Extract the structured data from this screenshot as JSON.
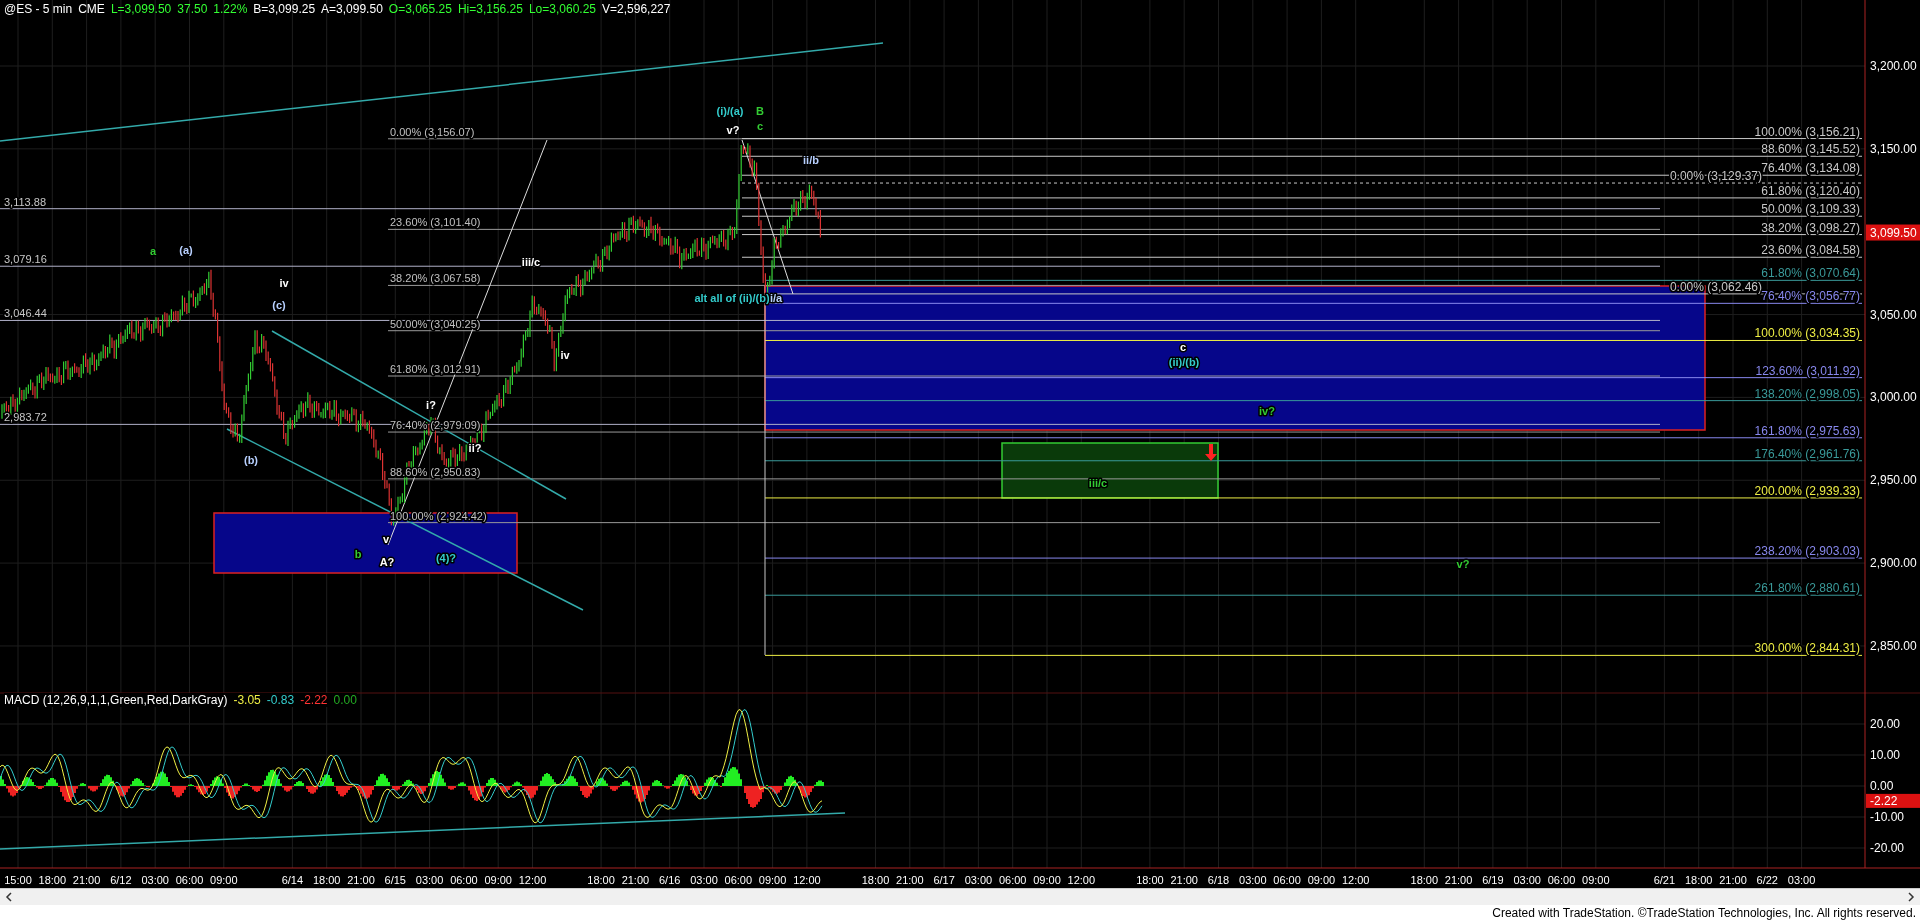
{
  "header": {
    "items": [
      {
        "text": "@ES - 5 min",
        "color": "#ffffff"
      },
      {
        "text": "CME",
        "color": "#ffffff"
      },
      {
        "text": "L=3,099.50",
        "color": "#33ff33"
      },
      {
        "text": "37.50",
        "color": "#33ff33"
      },
      {
        "text": "1.22%",
        "color": "#33ff33"
      },
      {
        "text": "B=3,099.25",
        "color": "#ffffff"
      },
      {
        "text": "A=3,099.50",
        "color": "#ffffff"
      },
      {
        "text": "O=3,065.25",
        "color": "#33ff33"
      },
      {
        "text": "Hi=3,156.25",
        "color": "#33ff33"
      },
      {
        "text": "Lo=3,060.25",
        "color": "#33ff33"
      },
      {
        "text": "V=2,596,227",
        "color": "#ffffff"
      }
    ]
  },
  "level_lines": [
    "3,113.88",
    "3,079.16",
    "3,046.44",
    "2,983.72"
  ],
  "left_fibs": [
    "0.00% (3,156.07)",
    "23.60% (3,101.40)",
    "38.20% (3,067.58)",
    "50.00% (3,040.25)",
    "61.80% (3,012.91)",
    "76.40% (2,979.09)",
    "88.60% (2,950.83)",
    "100.00% (2,924.42)"
  ],
  "right_fibs": [
    {
      "label": "100.00% (3,156.21)",
      "color": "#c8c8c8"
    },
    {
      "label": "88.60% (3,145.52)",
      "color": "#c8c8c8"
    },
    {
      "label": "76.40% (3,134.08)",
      "color": "#c8c8c8"
    },
    {
      "label": "0.00% (3,129.37)",
      "color": "#c8c8c8"
    },
    {
      "label": "61.80% (3,120.40)",
      "color": "#c8c8c8"
    },
    {
      "label": "50.00% (3,109.33)",
      "color": "#c8c8c8"
    },
    {
      "label": "38.20% (3,098.27)",
      "color": "#c8c8c8"
    },
    {
      "label": "23.60% (3,084.58)",
      "color": "#c8c8c8"
    },
    {
      "label": "61.80% (3,070.64)",
      "color": "#3a9a9a"
    },
    {
      "label": "0.00% (3,062.46)",
      "color": "#c8c8c8"
    },
    {
      "label": "76.40% (3,056.77)",
      "color": "#8888ee"
    },
    {
      "label": "100.00% (3,034.35)",
      "color": "#eeee44"
    },
    {
      "label": "123.60% (3,011.92)",
      "color": "#8888ee"
    },
    {
      "label": "138.20% (2,998.05)",
      "color": "#3a9a9a"
    },
    {
      "label": "161.80% (2,975.63)",
      "color": "#8888ee"
    },
    {
      "label": "176.40% (2,961.76)",
      "color": "#3a9a9a"
    },
    {
      "label": "200.00% (2,939.33)",
      "color": "#eeee44"
    },
    {
      "label": "238.20% (2,903.03)",
      "color": "#8888ee"
    },
    {
      "label": "261.80% (2,880.61)",
      "color": "#3a9a9a"
    },
    {
      "label": "300.00% (2,844.31)",
      "color": "#eeee44"
    }
  ],
  "wave_labels": [
    {
      "text": "a",
      "color": "#33cc33"
    },
    {
      "text": "(a)",
      "color": "#b8d0ff"
    },
    {
      "text": "iv",
      "color": "#ffffff"
    },
    {
      "text": "(c)",
      "color": "#b8d0ff"
    },
    {
      "text": "(b)",
      "color": "#b8d0ff"
    },
    {
      "text": "i?",
      "color": "#ffffff"
    },
    {
      "text": "ii?",
      "color": "#ffffff"
    },
    {
      "text": "iii/c",
      "color": "#ffffff"
    },
    {
      "text": "iv",
      "color": "#ffffff"
    },
    {
      "text": "v",
      "color": "#ffffff"
    },
    {
      "text": "b",
      "color": "#33cc33"
    },
    {
      "text": "A?",
      "color": "#ffffff"
    },
    {
      "text": "(4)?",
      "color": "#33cccc"
    },
    {
      "text": "(i)/(a)",
      "color": "#33cccc"
    },
    {
      "text": "B",
      "color": "#33cc33"
    },
    {
      "text": "v?",
      "color": "#ffffff"
    },
    {
      "text": "c",
      "color": "#33cc33"
    },
    {
      "text": "ii/b",
      "color": "#b8d0ff"
    },
    {
      "text": "alt all of (ii)/(b)",
      "color": "#33cccc"
    },
    {
      "text": "i/a",
      "color": "#b8d0ff"
    },
    {
      "text": "c",
      "color": "#ffffff"
    },
    {
      "text": "(ii)/(b)",
      "color": "#33cccc"
    },
    {
      "text": "iv?",
      "color": "#33cc33"
    },
    {
      "text": "iii/c",
      "color": "#33cc33"
    },
    {
      "text": "v?",
      "color": "#33cc33"
    }
  ],
  "price_axis": [
    "3,200.00",
    "3,150.00",
    "3,050.00",
    "3,000.00",
    "2,950.00",
    "2,900.00",
    "2,850.00"
  ],
  "current_price": "3,099.50",
  "macd": {
    "title": "MACD (12,26,9,1,1,Green,Red,DarkGray)",
    "values": [
      {
        "text": "-3.05",
        "color": "#eeee44"
      },
      {
        "text": "-0.83",
        "color": "#33cccc"
      },
      {
        "text": "-2.22",
        "color": "#ff3333"
      },
      {
        "text": "0.00",
        "color": "#22aa22"
      }
    ],
    "axis": [
      "20.00",
      "10.00",
      "0.00",
      "-10.00",
      "-20.00"
    ],
    "current": "-2.22"
  },
  "time_axis": [
    "15:00",
    "18:00",
    "21:00",
    "6/12",
    "03:00",
    "06:00",
    "09:00",
    "6/14",
    "18:00",
    "21:00",
    "6/15",
    "03:00",
    "06:00",
    "09:00",
    "12:00",
    "18:00",
    "21:00",
    "6/16",
    "03:00",
    "06:00",
    "09:00",
    "12:00",
    "18:00",
    "21:00",
    "6/17",
    "03:00",
    "06:00",
    "09:00",
    "12:00",
    "18:00",
    "21:00",
    "6/18",
    "03:00",
    "06:00",
    "09:00",
    "12:00",
    "18:00",
    "21:00",
    "6/19",
    "03:00",
    "06:00",
    "09:00",
    "6/21",
    "18:00",
    "21:00",
    "6/22",
    "03:00"
  ],
  "footer": "Created with TradeStation. ©TradeStation Technologies, Inc. All rights reserved."
}
